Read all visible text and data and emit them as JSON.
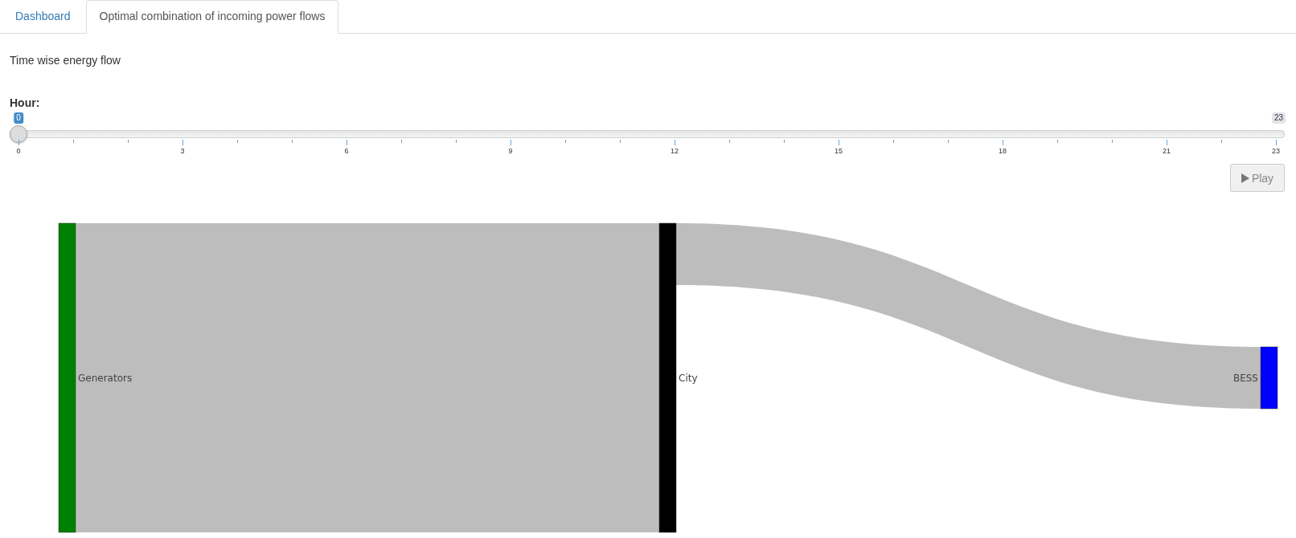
{
  "tabs": [
    {
      "label": "Dashboard",
      "selected": false
    },
    {
      "label": "Optimal combination of incoming power flows",
      "selected": true
    }
  ],
  "heading": "Time wise energy flow",
  "slider": {
    "label": "Hour:",
    "value_label": "0",
    "max_label": "23",
    "level": 0,
    "ticks": [
      "0",
      "3",
      "6",
      "9",
      "12",
      "15",
      "18",
      "21",
      "23"
    ]
  },
  "play_button": {
    "label": "Play"
  },
  "sankey": {
    "nodes": [
      {
        "label": "Generators",
        "color": "#008000"
      },
      {
        "label": "City",
        "color": "#000000"
      },
      {
        "label": "BESS",
        "color": "#0000ff"
      }
    ]
  }
}
